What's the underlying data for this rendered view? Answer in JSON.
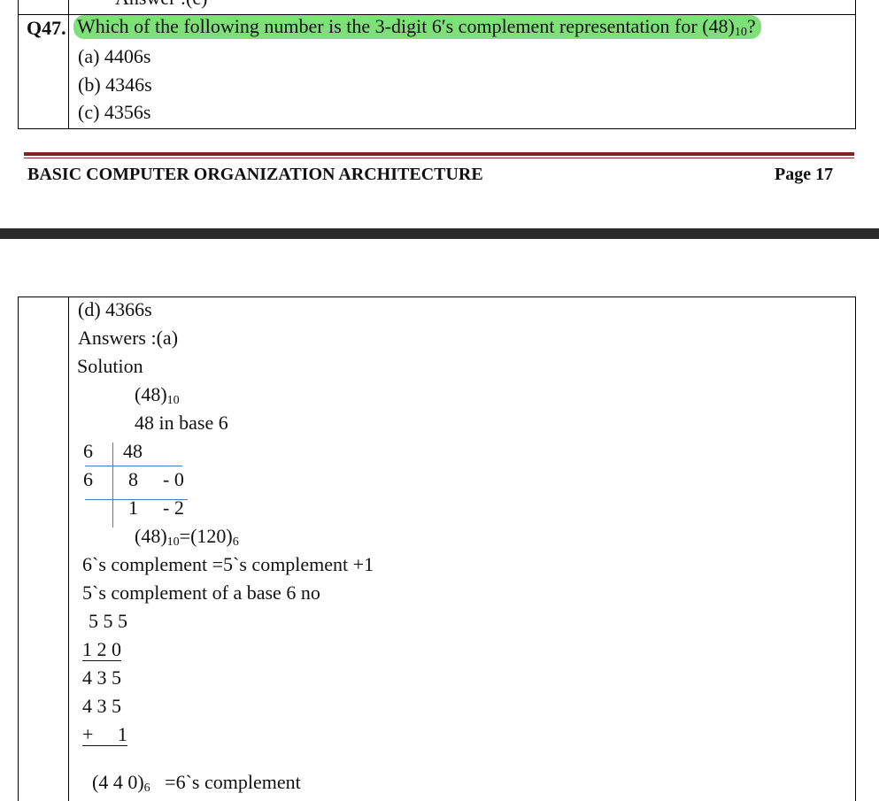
{
  "top": {
    "prev_answer": "Answer :(c)",
    "question_no": "Q47.",
    "question_text": "Which of the following number is the 3-digit 6′s complement representation for (48)",
    "question_sub": "10",
    "question_end": "?",
    "options": [
      "(a) 4406s",
      "(b) 4346s",
      "(c) 4356s"
    ]
  },
  "footer": {
    "title": "BASIC COMPUTER ORGANIZATION ARCHITECTURE",
    "page": "Page 17"
  },
  "bottom": {
    "option_d": "(d) 4366s",
    "answer": "Answers :(a)",
    "solution_label": "Solution",
    "given_num": "(48)",
    "given_sub": "10",
    "in_base": "48 in base 6",
    "division": {
      "r1_div": "6",
      "r1_val": "48",
      "r2_div": "6",
      "r2_val": "8",
      "r2_rem": "- 0",
      "r3_val": "1",
      "r3_rem": "- 2"
    },
    "result_a": "(48)",
    "result_a_sub": "10",
    "result_eq": "=(120)",
    "result_b_sub": "6",
    "line1": "6`s complement =5`s complement +1",
    "line2": "5`s complement of a base 6 no",
    "calc": [
      "5 5 5",
      "1 2 0",
      "4 3 5",
      "4 3 5",
      "+     1"
    ],
    "final_a": "(4 4 0)",
    "final_sub": "6",
    "final_b": "=6`s complement"
  }
}
